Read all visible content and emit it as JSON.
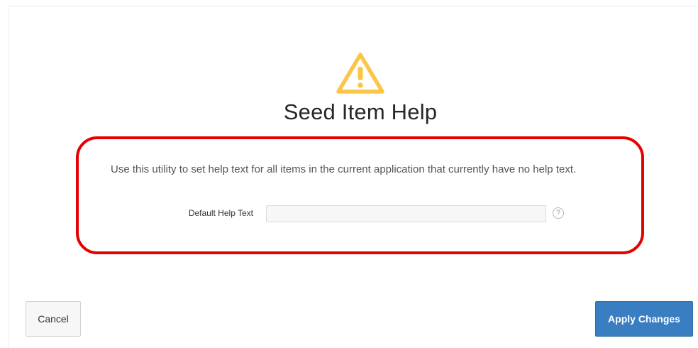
{
  "header": {
    "icon": "warning-icon",
    "icon_color": "#fbc546",
    "title": "Seed Item Help"
  },
  "form": {
    "description": "Use this utility to set help text for all items in the current application that currently have no help text.",
    "default_help_text": {
      "label": "Default Help Text",
      "value": "",
      "help_icon": "question-circle-icon",
      "help_glyph": "?"
    },
    "highlight_color": "#e60000"
  },
  "footer": {
    "cancel_label": "Cancel",
    "apply_label": "Apply Changes",
    "apply_color": "#3a7ec2"
  }
}
